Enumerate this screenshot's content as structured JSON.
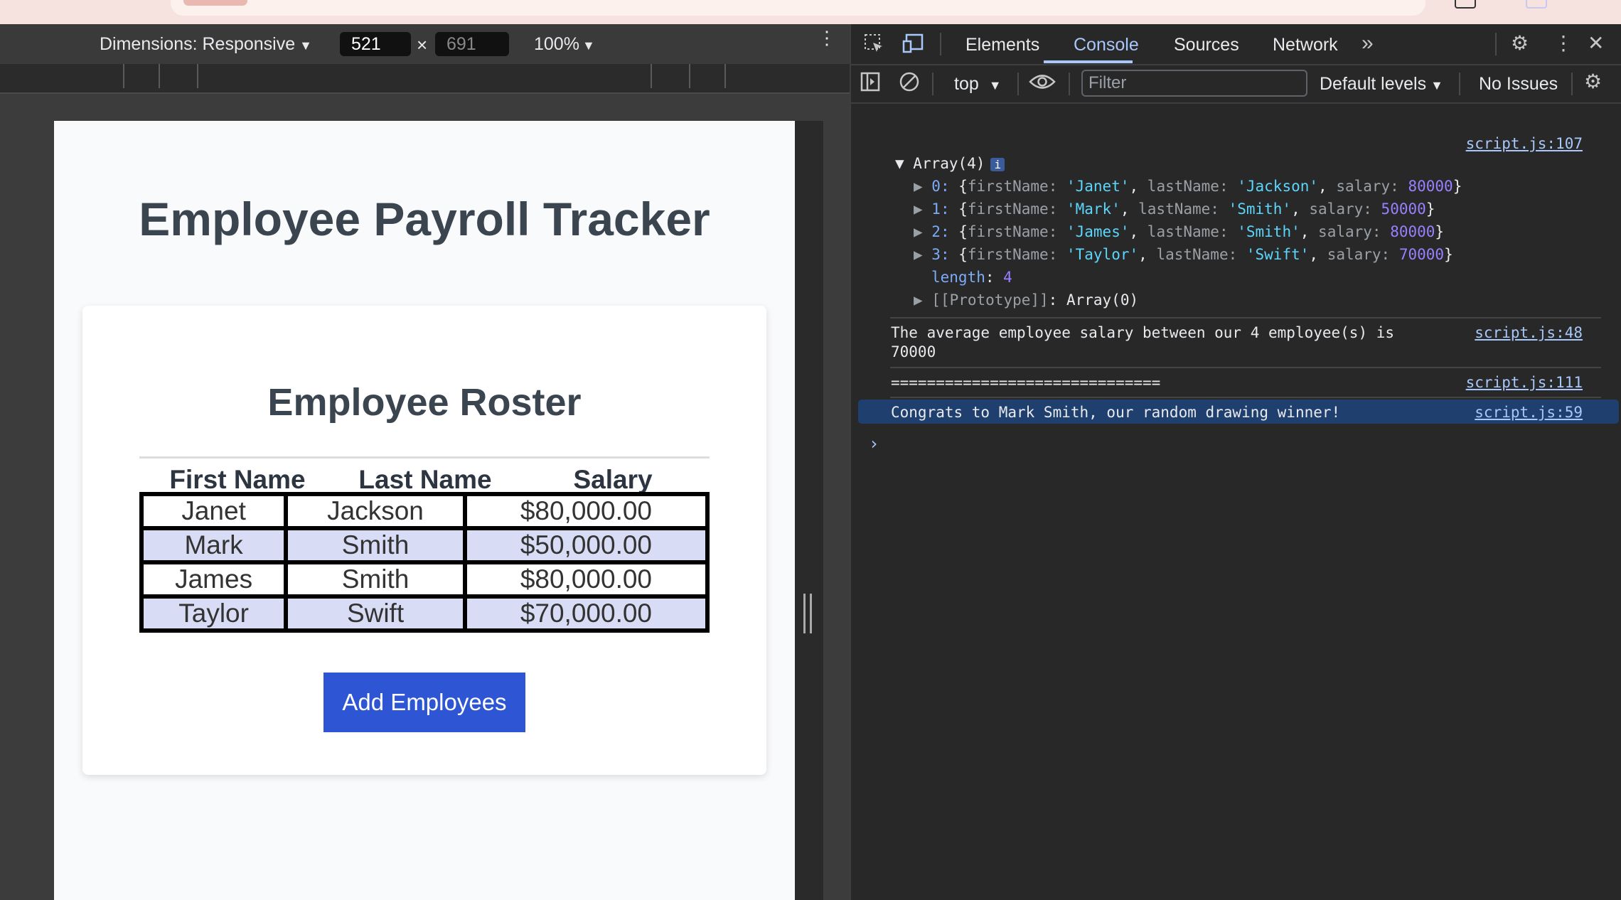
{
  "device_toolbar": {
    "dimensions_label": "Dimensions: Responsive",
    "width": "521",
    "height": "691",
    "times": "×",
    "zoom": "100%"
  },
  "page": {
    "title": "Employee Payroll Tracker",
    "card_title": "Employee Roster",
    "columns": [
      "First Name",
      "Last Name",
      "Salary"
    ],
    "rows": [
      [
        "Janet",
        "Jackson",
        "$80,000.00"
      ],
      [
        "Mark",
        "Smith",
        "$50,000.00"
      ],
      [
        "James",
        "Smith",
        "$80,000.00"
      ],
      [
        "Taylor",
        "Swift",
        "$70,000.00"
      ]
    ],
    "add_button": "Add Employees"
  },
  "devtools": {
    "tabs": [
      "Elements",
      "Console",
      "Sources",
      "Network"
    ],
    "active_tab": "Console",
    "context": "top",
    "filter_placeholder": "Filter",
    "levels": "Default levels",
    "issues": "No Issues",
    "console": {
      "array_src": "script.js:107",
      "array_label": "Array(4)",
      "info_badge": "i",
      "entries": [
        {
          "idx": "0",
          "first": "'Janet'",
          "last": "'Jackson'",
          "salary": "80000"
        },
        {
          "idx": "1",
          "first": "'Mark'",
          "last": "'Smith'",
          "salary": "50000"
        },
        {
          "idx": "2",
          "first": "'James'",
          "last": "'Smith'",
          "salary": "80000"
        },
        {
          "idx": "3",
          "first": "'Taylor'",
          "last": "'Swift'",
          "salary": "70000"
        }
      ],
      "length_label": "length",
      "length_value": "4",
      "prototype_label": "[[Prototype]]",
      "prototype_value": "Array(0)",
      "avg_line1": "The average employee salary between our 4 employee(s) is",
      "avg_line2": "70000",
      "avg_src": "script.js:48",
      "separator": "==============================",
      "sep_src": "script.js:111",
      "winner": "Congrats to Mark Smith, our random drawing winner!",
      "winner_src": "script.js:59",
      "prompt": "›"
    }
  },
  "colors": {
    "accent_button": "#2d55d4",
    "row_alt": "#d8ddf5",
    "devtools_accent": "#a8c7fa"
  }
}
